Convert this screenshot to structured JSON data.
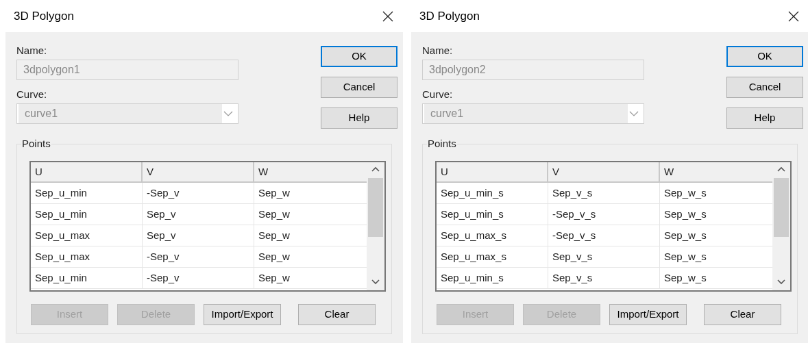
{
  "dialogs": [
    {
      "title": "3D Polygon",
      "name_field": {
        "label": "Name:",
        "value": "3dpolygon1",
        "disabled": true
      },
      "curve_field": {
        "label": "Curve:",
        "value": "curve1",
        "disabled": true
      },
      "buttons": [
        {
          "label": "OK",
          "default": true
        },
        {
          "label": "Cancel",
          "default": false
        },
        {
          "label": "Help",
          "default": false
        }
      ],
      "points": {
        "title": "Points",
        "columns": [
          "U",
          "V",
          "W"
        ],
        "rows": [
          [
            "Sep_u_min",
            "-Sep_v",
            "Sep_w"
          ],
          [
            "Sep_u_min",
            "Sep_v",
            "Sep_w"
          ],
          [
            "Sep_u_max",
            "Sep_v",
            "Sep_w"
          ],
          [
            "Sep_u_max",
            "-Sep_v",
            "Sep_w"
          ],
          [
            "Sep_u_min",
            "-Sep_v",
            "Sep_w"
          ]
        ],
        "buttons": [
          {
            "label": "Insert",
            "disabled": true
          },
          {
            "label": "Delete",
            "disabled": true
          },
          {
            "label": "Import/Export",
            "disabled": false
          },
          {
            "label": "Clear",
            "disabled": false
          }
        ]
      }
    },
    {
      "title": "3D Polygon",
      "name_field": {
        "label": "Name:",
        "value": "3dpolygon2",
        "disabled": true
      },
      "curve_field": {
        "label": "Curve:",
        "value": "curve1",
        "disabled": true
      },
      "buttons": [
        {
          "label": "OK",
          "default": true
        },
        {
          "label": "Cancel",
          "default": false
        },
        {
          "label": "Help",
          "default": false
        }
      ],
      "points": {
        "title": "Points",
        "columns": [
          "U",
          "V",
          "W"
        ],
        "rows": [
          [
            "Sep_u_min_s",
            "Sep_v_s",
            "Sep_w_s"
          ],
          [
            "Sep_u_min_s",
            "-Sep_v_s",
            "Sep_w_s"
          ],
          [
            "Sep_u_max_s",
            "-Sep_v_s",
            "Sep_w_s"
          ],
          [
            "Sep_u_max_s",
            "Sep_v_s",
            "Sep_w_s"
          ],
          [
            "Sep_u_min_s",
            "Sep_v_s",
            "Sep_w_s"
          ]
        ],
        "buttons": [
          {
            "label": "Insert",
            "disabled": true
          },
          {
            "label": "Delete",
            "disabled": true
          },
          {
            "label": "Import/Export",
            "disabled": false
          },
          {
            "label": "Clear",
            "disabled": false
          }
        ]
      }
    }
  ]
}
